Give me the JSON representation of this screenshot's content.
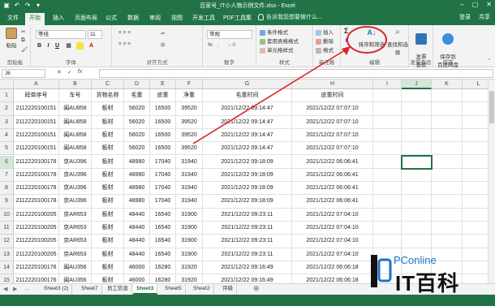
{
  "titlebar": {
    "title": "百家号_IT小人物示例文件.xlsx - Excel",
    "window_buttons": [
      "–",
      "▢",
      "✕"
    ]
  },
  "tabs": [
    "文件",
    "开始",
    "插入",
    "页面布局",
    "公式",
    "数据",
    "审阅",
    "视图",
    "开发工具",
    "PDF工具集"
  ],
  "active_tab": "开始",
  "tell_me": "告诉我您想要做什么...",
  "right_links": {
    "login": "登录",
    "share": "共享"
  },
  "ribbon": {
    "clipboard": {
      "label": "剪贴板",
      "paste": "粘贴"
    },
    "font": {
      "label": "字体",
      "font_name": "等线",
      "font_size": "11",
      "bold": "B",
      "italic": "I",
      "underline": "U"
    },
    "alignment": {
      "label": "对齐方式"
    },
    "number": {
      "label": "数字",
      "format": "常规",
      "percent": "%"
    },
    "styles": {
      "label": "样式",
      "conditional": "条件格式",
      "table_format": "套用表格格式",
      "cell_styles": "单元格样式"
    },
    "cells": {
      "label": "单元格",
      "insert": "插入",
      "delete": "删除",
      "format": "格式"
    },
    "editing": {
      "label": "编辑",
      "sort_filter": "排序和筛选",
      "find_select": "查找和选择"
    },
    "invoice": {
      "label": "发票查验",
      "btn": "发票\n查验"
    },
    "baidu": {
      "label": "保存",
      "btn": "保存到\n百度网盘"
    }
  },
  "formula_bar": {
    "name_box": "J6",
    "fx": "fx"
  },
  "columns": [
    "A",
    "B",
    "C",
    "D",
    "E",
    "F",
    "G",
    "H",
    "I",
    "J",
    "K",
    "L"
  ],
  "selected_column": "J",
  "row_numbers": [
    "1",
    "2",
    "3",
    "4",
    "5",
    "6",
    "7",
    "8",
    "9",
    "10",
    "11",
    "12",
    "13",
    "14",
    "15"
  ],
  "selected_row": "6",
  "table": {
    "headers": [
      "磅单序号",
      "车号",
      "货物名称",
      "毛重",
      "皮重",
      "净重",
      "毛重时间",
      "皮重时间"
    ],
    "rows": [
      [
        "2112220100151",
        "闽AU858",
        "板材",
        "56020",
        "16500",
        "39520",
        "2021/12/22 09:14:47",
        "2021/12/22 07:07:10"
      ],
      [
        "2112220100151",
        "闽AU858",
        "板材",
        "56020",
        "16500",
        "39520",
        "2021/12/22 09:14:47",
        "2021/12/22 07:07:10"
      ],
      [
        "2112220100151",
        "闽AU858",
        "板材",
        "56020",
        "16500",
        "39520",
        "2021/12/22 09:14:47",
        "2021/12/22 07:07:10"
      ],
      [
        "2112220100151",
        "闽AU858",
        "板材",
        "56020",
        "16500",
        "39520",
        "2021/12/22 09:14:47",
        "2021/12/22 07:07:10"
      ],
      [
        "2112220100178",
        "京AU396",
        "板材",
        "48980",
        "17040",
        "31940",
        "2021/12/22 09:18:09",
        "2021/12/22 06:06:41"
      ],
      [
        "2112220100178",
        "京AU396",
        "板材",
        "48980",
        "17040",
        "31940",
        "2021/12/22 09:18:09",
        "2021/12/22 06:06:41"
      ],
      [
        "2112220100178",
        "京AU396",
        "板材",
        "48980",
        "17040",
        "31940",
        "2021/12/22 09:18:09",
        "2021/12/22 06:06:41"
      ],
      [
        "2112220100178",
        "京AU396",
        "板材",
        "48980",
        "17040",
        "31940",
        "2021/12/22 09:18:09",
        "2021/12/22 06:06:41"
      ],
      [
        "2112220100205",
        "京AR653",
        "板材",
        "48440",
        "16540",
        "31900",
        "2021/12/22 09:23:11",
        "2021/12/22 07:04:10"
      ],
      [
        "2112220100205",
        "京AR653",
        "板材",
        "48440",
        "16540",
        "31900",
        "2021/12/22 09:23:11",
        "2021/12/22 07:04:10"
      ],
      [
        "2112220100205",
        "京AR653",
        "板材",
        "48440",
        "16540",
        "31900",
        "2021/12/22 09:23:11",
        "2021/12/22 07:04:10"
      ],
      [
        "2112220100205",
        "京AR653",
        "板材",
        "48440",
        "16540",
        "31900",
        "2021/12/22 09:23:11",
        "2021/12/22 07:04:10"
      ],
      [
        "2112220100176",
        "闽AU356",
        "板材",
        "46000",
        "16280",
        "31920",
        "2021/12/22 09:16:49",
        "2021/12/22 06:06:18"
      ],
      [
        "2112220100176",
        "闽AU356",
        "板材",
        "46000",
        "16280",
        "31920",
        "2021/12/22 09:16:49",
        "2021/12/22 06:06:18"
      ]
    ]
  },
  "sheet_tabs": [
    "Sheet3 (2)",
    "Sheet7",
    "员工信息",
    "Sheet3",
    "Sheet5",
    "Sheet2",
    "评级"
  ],
  "active_sheet": "Sheet3",
  "watermark": {
    "top": "PConline",
    "big": "IT百科"
  },
  "colors": {
    "excel_green": "#217346",
    "annotation_red": "#d9262c",
    "watermark_blue": "#1a74c9"
  }
}
